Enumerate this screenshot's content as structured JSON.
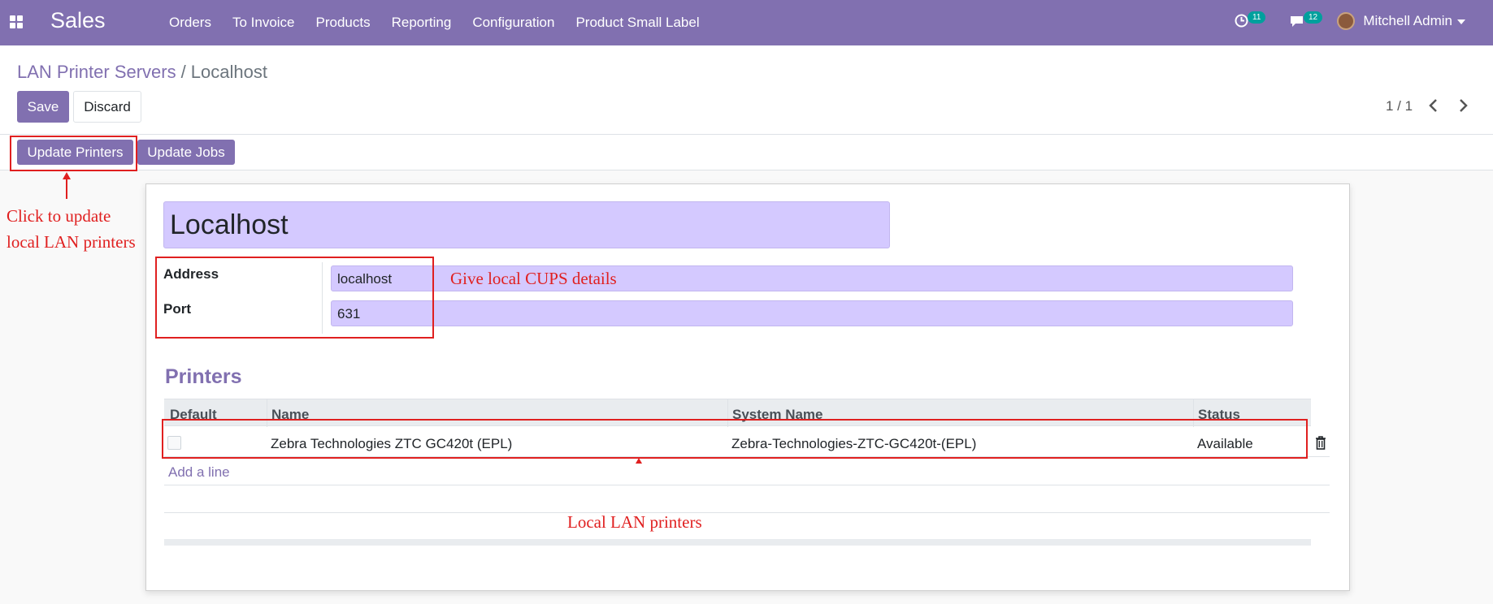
{
  "navbar": {
    "app_name": "Sales",
    "menu": [
      "Orders",
      "To Invoice",
      "Products",
      "Reporting",
      "Configuration",
      "Product Small Label"
    ],
    "activity_count": "11",
    "message_count": "12",
    "user_name": "Mitchell Admin"
  },
  "breadcrumb": {
    "parent": "LAN Printer Servers",
    "separator": "/",
    "current": "Localhost"
  },
  "buttons": {
    "save": "Save",
    "discard": "Discard",
    "update_printers": "Update Printers",
    "update_jobs": "Update Jobs"
  },
  "pager": {
    "value": "1 / 1"
  },
  "form": {
    "name": "Localhost",
    "address_label": "Address",
    "address_value": "localhost",
    "port_label": "Port",
    "port_value": "631"
  },
  "printers": {
    "title": "Printers",
    "columns": [
      "Default",
      "Name",
      "System Name",
      "Status"
    ],
    "rows": [
      {
        "default": false,
        "name": "Zebra Technologies ZTC GC420t (EPL)",
        "system_name": "Zebra-Technologies-ZTC-GC420t-(EPL)",
        "status": "Available"
      }
    ],
    "add_line": "Add a line"
  },
  "annotations": {
    "update_printers_line1": "Click to update",
    "update_printers_line2": "local LAN printers",
    "cups": "Give local CUPS details",
    "lan_printers": "Local LAN printers"
  },
  "colors": {
    "brand": "#8170b0",
    "input_bg": "#d4c9ff",
    "annotation": "#e02020",
    "badge": "#00a09d"
  }
}
